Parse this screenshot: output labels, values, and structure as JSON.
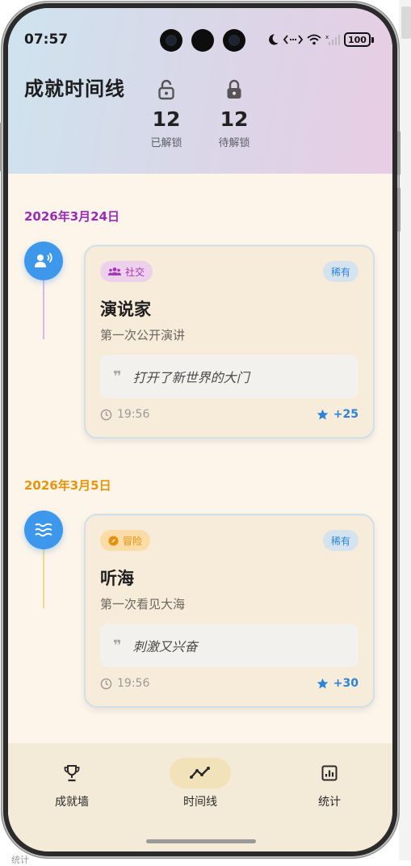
{
  "status_bar": {
    "time": "07:57",
    "battery": "100"
  },
  "header": {
    "title": "成就时间线",
    "unlocked": {
      "count": "12",
      "label": "已解锁"
    },
    "locked": {
      "count": "12",
      "label": "待解锁"
    }
  },
  "timeline": [
    {
      "date": "2026年3月24日",
      "date_color": "#9b2bb5",
      "line_color": "#d9b7e6",
      "node_icon": "speaker-person-icon",
      "category": "社交",
      "category_icon": "group-icon",
      "category_bg": "#ecd0ec",
      "category_color": "#a437b2",
      "rarity": "稀有",
      "title": "演说家",
      "subtitle": "第一次公开演讲",
      "quote": "打开了新世界的大门",
      "time": "19:56",
      "points": "+25"
    },
    {
      "date": "2026年3月5日",
      "date_color": "#e8950c",
      "line_color": "#f0d891",
      "node_icon": "waves-icon",
      "category": "冒险",
      "category_icon": "compass-icon",
      "category_bg": "#fbdca6",
      "category_color": "#e69010",
      "rarity": "稀有",
      "title": "听海",
      "subtitle": "第一次看见大海",
      "quote": "刺激又兴奋",
      "time": "19:56",
      "points": "+30"
    }
  ],
  "tabs": [
    {
      "label": "成就墙",
      "icon": "trophy-icon",
      "active": false
    },
    {
      "label": "时间线",
      "icon": "timeline-icon",
      "active": true
    },
    {
      "label": "统计",
      "icon": "stats-icon",
      "active": false
    }
  ],
  "background_peek": "统计",
  "colors": {
    "accent_blue": "#2b84d9",
    "node_blue": "#3d97ea",
    "card_bg": "#f7ebd9",
    "page_bg": "#fdf5ea"
  }
}
